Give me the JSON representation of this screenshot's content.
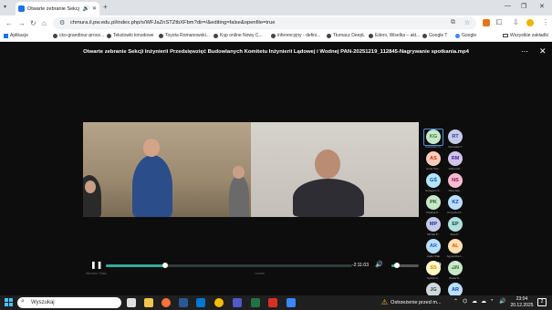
{
  "browser": {
    "tab_title": "Otwarte zebranie Sekcji Inżynierii Przedsięwzięć Budowlanych Komitetu Inżynierii Lądowej i Wodnej PAN",
    "url": "chmura.il.pw.edu.pl/index.php/s/WFJaZnSTZtbXFbm?dir=/&editing=false&openfile=true"
  },
  "bookmarks": [
    {
      "label": "Aplikacje",
      "icon": "apps-grid-icon"
    },
    {
      "label": "cko-grandtour-proce...",
      "icon": "site-icon"
    },
    {
      "label": "Tekstowki kmodowe",
      "icon": "site-icon"
    },
    {
      "label": "Toyota Romanowski...",
      "icon": "site-icon"
    },
    {
      "label": "Kup online Nowy C...",
      "icon": "site-icon"
    },
    {
      "label": "inferencyjny - defini...",
      "icon": "site-icon"
    },
    {
      "label": "Tłumacz DeepL",
      "icon": "site-icon"
    },
    {
      "label": "Edeni, Wiselka – akt...",
      "icon": "site-icon"
    },
    {
      "label": "Google T",
      "icon": "site-icon"
    },
    {
      "label": "Google",
      "icon": "google-icon"
    },
    {
      "label": "Wszystkie zakładki",
      "icon": "folder-icon"
    }
  ],
  "viewer": {
    "title": "Otwarte zebranie Sekcji Inżynierii Przedsięwzięć Budowlanych Komitetu Inżynierii Lądowej i Wodnej PAN-20251219_112845-Nagrywanie spotkania.mp4",
    "participants": [
      {
        "initials": "KG",
        "name": "Kazimierz G.",
        "bg": "#c8e6c9",
        "fg": "#2e7d32"
      },
      {
        "initials": "RT",
        "name": "Romuald T.",
        "bg": "#c5cae9",
        "fg": "#303f9f"
      },
      {
        "initials": "AS",
        "name": "Anna Sob...",
        "bg": "#ffccbc",
        "fg": "#bf360c"
      },
      {
        "initials": "RM",
        "name": "Robert M...",
        "bg": "#d1c4e9",
        "fg": "#4527a0"
      },
      {
        "initials": "GŚ",
        "name": "Grzegorz Ś...",
        "bg": "#b3e5fc",
        "fg": "#01579b"
      },
      {
        "initials": "NS",
        "name": "Nina Sob...",
        "bg": "#f8bbd0",
        "fg": "#880e4f"
      },
      {
        "initials": "PK",
        "name": "Paulina K...",
        "bg": "#c8e6c9",
        "fg": "#1b5e20"
      },
      {
        "initials": "KZ",
        "name": "Krzysztof Z...",
        "bg": "#bbdefb",
        "fg": "#0d47a1"
      },
      {
        "initials": "MP",
        "name": "Michał P...",
        "bg": "#c5cae9",
        "fg": "#283593"
      },
      {
        "initials": "EP",
        "name": "Ewa P...",
        "bg": "#b2dfdb",
        "fg": "#004d40"
      },
      {
        "initials": "AR",
        "name": "Adam Rak",
        "bg": "#bbdefb",
        "fg": "#1565c0"
      },
      {
        "initials": "AL",
        "name": "Agnieszka L...",
        "bg": "#ffe0b2",
        "fg": "#e65100"
      },
      {
        "initials": "SS",
        "name": "Sylwia S...",
        "bg": "#fff9c4",
        "fg": "#f57f17"
      },
      {
        "initials": "BN",
        "name": "Beata N...",
        "bg": "#c8e6c9",
        "fg": "#33691e"
      },
      {
        "initials": "JG",
        "name": "Jan G...",
        "bg": "#cfd8dc",
        "fg": "#37474f"
      },
      {
        "initials": "AR",
        "name": "Artur R...",
        "bg": "#bbdefb",
        "fg": "#0d47a1"
      }
    ],
    "time_remaining": "-2:11:03",
    "progress": 0.24,
    "volume": 0.2,
    "caption_left": "Wieslaw Trilski",
    "caption_right": "Leszek"
  },
  "taskbar": {
    "search_placeholder": "Wyszukaj",
    "notice": "Ostrzeżenie przed m...",
    "time": "23:04",
    "date": "20.12.2025",
    "notif_count": "2"
  }
}
